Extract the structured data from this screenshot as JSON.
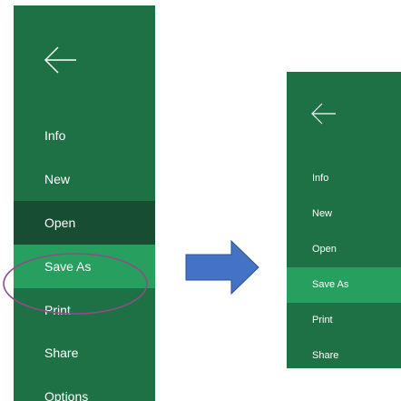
{
  "menu_left": {
    "items": [
      {
        "label": "Info"
      },
      {
        "label": "New"
      },
      {
        "label": "Open"
      },
      {
        "label": "Save As"
      },
      {
        "label": "Print"
      },
      {
        "label": "Share"
      },
      {
        "label": "Options"
      }
    ]
  },
  "menu_right": {
    "items": [
      {
        "label": "Info"
      },
      {
        "label": "New"
      },
      {
        "label": "Open"
      },
      {
        "label": "Save As"
      },
      {
        "label": "Print"
      },
      {
        "label": "Share"
      }
    ]
  },
  "colors": {
    "panel_background": "#1e7145",
    "selected_item": "#27a05f",
    "hovered_item": "#174e32",
    "arrow_fill": "#4472c4",
    "highlight_outline": "#8e4d84"
  },
  "icons": {
    "back": "back-arrow-icon",
    "transition": "right-arrow-icon"
  }
}
